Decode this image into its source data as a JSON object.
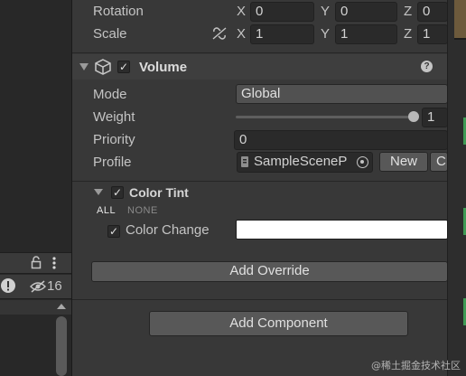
{
  "transform": {
    "rotation_label": "Rotation",
    "scale_label": "Scale",
    "rotation": {
      "x": "0",
      "y": "0",
      "z": "0"
    },
    "scale": {
      "x": "1",
      "y": "1",
      "z": "1"
    },
    "axis_x": "X",
    "axis_y": "Y",
    "axis_z": "Z"
  },
  "volume": {
    "title": "Volume",
    "mode_label": "Mode",
    "mode_value": "Global",
    "weight_label": "Weight",
    "weight_value": "1",
    "weight_fraction": 1.0,
    "priority_label": "Priority",
    "priority_value": "0",
    "profile_label": "Profile",
    "profile_value": "SampleSceneP",
    "new_button": "New",
    "clone_button": "C"
  },
  "color_tint": {
    "title": "Color Tint",
    "all_label": "ALL",
    "none_label": "NONE",
    "color_change_label": "Color Change",
    "color_value": "#ffffff"
  },
  "buttons": {
    "add_override": "Add Override",
    "add_component": "Add Component"
  },
  "left_panel": {
    "hidden_count": "16"
  },
  "watermark": "@稀土掘金技术社区",
  "colors": {
    "background": "#383838",
    "field": "#2a2a2a",
    "button": "#585858",
    "accent_green": "#3f9a55"
  }
}
